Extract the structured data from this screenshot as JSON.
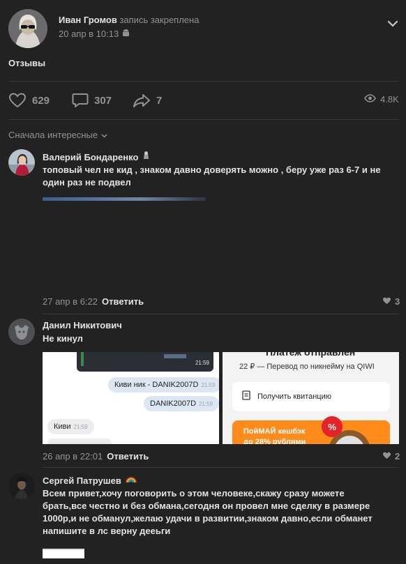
{
  "post": {
    "author": "Иван Громов",
    "pinned": "запись закреплена",
    "date": "20 апр в 10:13",
    "text": "Отзывы",
    "likes": "629",
    "comments": "307",
    "shares": "7",
    "views": "4.8K"
  },
  "sort_label": "Сначала интересные",
  "comments": [
    {
      "name": "Валерий Бондаренко",
      "text_line1": "топовый чел не кид , знаком давно доверять можно , беру уже раз 6-7 и не",
      "text_line2": "один раз не подвел",
      "date": "27 апр в 6:22",
      "reply": "Ответить",
      "likes": "3"
    },
    {
      "name": "Данил Никитович",
      "text": "Не кинул",
      "date": "26 апр в 22:01",
      "reply": "Ответить",
      "likes": "2",
      "chat": {
        "time_top": "21:59",
        "msg1": "Киви ник - DANIK2007D",
        "msg1_time": "21:59",
        "msg2": "DANIK2007D",
        "msg2_time": "21:59",
        "msg3": "Киви",
        "msg3_time": "21:59",
        "tag": "DANIK2007D"
      },
      "receipt": {
        "header": "Платеж отправлен",
        "transfer": "22 ₽ — Перевод по никнейму на QIWI",
        "button": "Получить квитанцию",
        "promo1": "ПойМАЙ кешбэк",
        "promo2": "до 28% рублями",
        "promo_badge": "%"
      }
    },
    {
      "name": "Сергей Патрушев",
      "text_line1": "Всем привет,хочу поговорить о этом человеке,скажу сразу можете",
      "text_line2": "брать,все честно и без обмана,сегодня он провел мне сделку в размере",
      "text_line3": "1000р,и не обманул,желаю удачи в развитии,знаком давно,если обманет",
      "text_line4": "напишите в лс верну дееьги"
    }
  ]
}
